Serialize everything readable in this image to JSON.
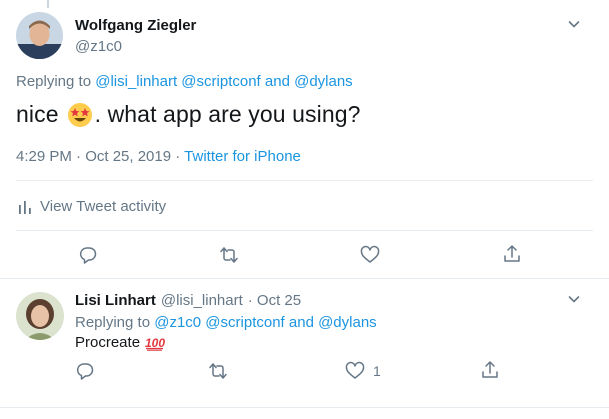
{
  "main_tweet": {
    "author_name": "Wolfgang Ziegler",
    "author_handle": "@z1c0",
    "replying_prefix": "Replying to",
    "replying_to": "@lisi_linhart @scriptconf and @dylans",
    "text_before": "nice",
    "emoji": "star-struck",
    "text_after": ". what app are you using?",
    "timestamp": "4:29 PM · Oct 25, 2019 ·",
    "source": "Twitter for iPhone",
    "activity_label": "View Tweet activity"
  },
  "reply_tweet": {
    "author_name": "Lisi Linhart",
    "author_handle": "@lisi_linhart",
    "date": "· Oct 25",
    "replying_prefix": "Replying to",
    "replying_to": "@z1c0 @scriptconf and @dylans",
    "text": "Procreate",
    "emoji": "100",
    "like_count": "1"
  },
  "icons": [
    "chevron-down-icon",
    "reply-icon",
    "retweet-icon",
    "like-icon",
    "share-icon",
    "bar-chart-icon"
  ],
  "colors": {
    "link": "#1b95e0",
    "muted": "#657786",
    "text": "#14171a",
    "divider": "#e6ecf0"
  }
}
